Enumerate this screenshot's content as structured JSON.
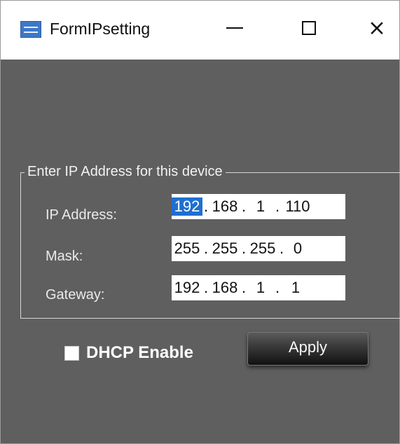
{
  "window": {
    "title": "FormIPsetting",
    "icon": "app-icon",
    "controls": {
      "minimize": "minimize-icon",
      "maximize": "maximize-icon",
      "close": "×"
    }
  },
  "ip_settings": {
    "group_title": "Enter IP Address for this device",
    "ip_address": {
      "label": "IP Address:",
      "octets": [
        "192",
        "168",
        "1",
        "110"
      ],
      "selected_octet": "192"
    },
    "mask": {
      "label": "Mask:",
      "octets": [
        "255",
        "255",
        "255",
        "0"
      ]
    },
    "gateway": {
      "label": "Gateway:",
      "octets": [
        "192",
        "168",
        "1",
        "1"
      ]
    }
  },
  "options": {
    "dhcp_label": "DHCP Enable",
    "dhcp_checked": false
  },
  "actions": {
    "apply_label": "Apply"
  },
  "colors": {
    "window_background": "#5f5f5f",
    "selection": "#1f6fd1"
  }
}
